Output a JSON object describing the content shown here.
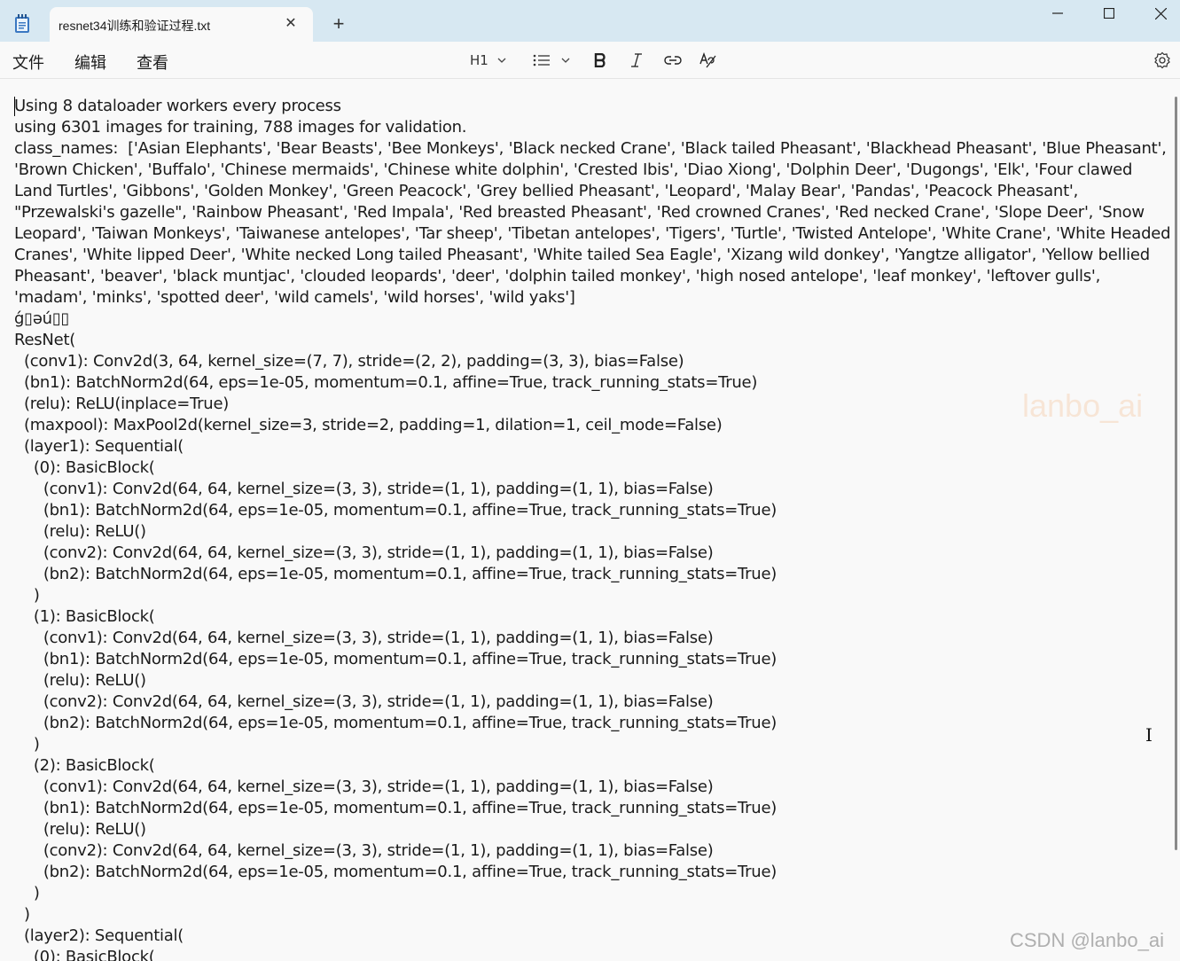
{
  "window": {
    "tab_title": "resnet34训练和验证过程.txt",
    "tab_close_glyph": "✕",
    "new_tab_glyph": "+",
    "controls": {
      "minimize": "—",
      "maximize": "☐",
      "close": "✕"
    }
  },
  "menu": {
    "file": "文件",
    "edit": "编辑",
    "view": "查看"
  },
  "toolbar": {
    "heading_label": "H1",
    "chevron": "⌵",
    "icons": [
      "heading-dropdown-icon",
      "list-icon",
      "bold-icon",
      "italic-icon",
      "link-icon",
      "clear-formatting-icon",
      "settings-icon"
    ]
  },
  "document": {
    "lines": [
      "Using 8 dataloader workers every process",
      "using 6301 images for training, 788 images for validation.",
      "class_names:  ['Asian Elephants', 'Bear Beasts', 'Bee Monkeys', 'Black necked Crane', 'Black tailed Pheasant', 'Blackhead Pheasant', 'Blue Pheasant', 'Brown Chicken', 'Buffalo', 'Chinese mermaids', 'Chinese white dolphin', 'Crested Ibis', 'Diao Xiong', 'Dolphin Deer', 'Dugongs', 'Elk', 'Four clawed Land Turtles', 'Gibbons', 'Golden Monkey', 'Green Peacock', 'Grey bellied Pheasant', 'Leopard', 'Malay Bear', 'Pandas', 'Peacock Pheasant', \"Przewalski's gazelle\", 'Rainbow Pheasant', 'Red Impala', 'Red breasted Pheasant', 'Red crowned Cranes', 'Red necked Crane', 'Slope Deer', 'Snow Leopard', 'Taiwan Monkeys', 'Taiwanese antelopes', 'Tar sheep', 'Tibetan antelopes', 'Tigers', 'Turtle', 'Twisted Antelope', 'White Crane', 'White Headed Cranes', 'White lipped Deer', 'White necked Long tailed Pheasant', 'White tailed Sea Eagle', 'Xizang wild donkey', 'Yangtze alligator', 'Yellow bellied Pheasant', 'beaver', 'black muntjac', 'clouded leopards', 'deer', 'dolphin tailed monkey', 'high nosed antelope', 'leaf monkey', 'leftover gulls', 'madam', 'minks', 'spotted deer', 'wild camels', 'wild horses', 'wild yaks']",
      "ǵ▯əú▯▯",
      "ResNet(",
      "  (conv1): Conv2d(3, 64, kernel_size=(7, 7), stride=(2, 2), padding=(3, 3), bias=False)",
      "  (bn1): BatchNorm2d(64, eps=1e-05, momentum=0.1, affine=True, track_running_stats=True)",
      "  (relu): ReLU(inplace=True)",
      "  (maxpool): MaxPool2d(kernel_size=3, stride=2, padding=1, dilation=1, ceil_mode=False)",
      "  (layer1): Sequential(",
      "    (0): BasicBlock(",
      "      (conv1): Conv2d(64, 64, kernel_size=(3, 3), stride=(1, 1), padding=(1, 1), bias=False)",
      "      (bn1): BatchNorm2d(64, eps=1e-05, momentum=0.1, affine=True, track_running_stats=True)",
      "      (relu): ReLU()",
      "      (conv2): Conv2d(64, 64, kernel_size=(3, 3), stride=(1, 1), padding=(1, 1), bias=False)",
      "      (bn2): BatchNorm2d(64, eps=1e-05, momentum=0.1, affine=True, track_running_stats=True)",
      "    )",
      "    (1): BasicBlock(",
      "      (conv1): Conv2d(64, 64, kernel_size=(3, 3), stride=(1, 1), padding=(1, 1), bias=False)",
      "      (bn1): BatchNorm2d(64, eps=1e-05, momentum=0.1, affine=True, track_running_stats=True)",
      "      (relu): ReLU()",
      "      (conv2): Conv2d(64, 64, kernel_size=(3, 3), stride=(1, 1), padding=(1, 1), bias=False)",
      "      (bn2): BatchNorm2d(64, eps=1e-05, momentum=0.1, affine=True, track_running_stats=True)",
      "    )",
      "    (2): BasicBlock(",
      "      (conv1): Conv2d(64, 64, kernel_size=(3, 3), stride=(1, 1), padding=(1, 1), bias=False)",
      "      (bn1): BatchNorm2d(64, eps=1e-05, momentum=0.1, affine=True, track_running_stats=True)",
      "      (relu): ReLU()",
      "      (conv2): Conv2d(64, 64, kernel_size=(3, 3), stride=(1, 1), padding=(1, 1), bias=False)",
      "      (bn2): BatchNorm2d(64, eps=1e-05, momentum=0.1, affine=True, track_running_stats=True)",
      "    )",
      "  )",
      "  (layer2): Sequential(",
      "    (0): BasicBlock("
    ]
  },
  "watermarks": {
    "center": "lanbo_ai",
    "corner": "CSDN @lanbo_ai"
  },
  "colors": {
    "titlebar": "#d7e8f2",
    "editor_bg": "#f9f9f9",
    "text": "#1b1b1b"
  }
}
